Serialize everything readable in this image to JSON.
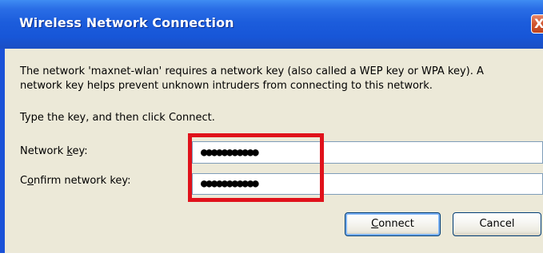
{
  "window": {
    "title": "Wireless Network Connection",
    "close_label": "X"
  },
  "message": {
    "line1": "The network 'maxnet-wlan' requires a network key (also called a WEP key or WPA key). A",
    "line2": "network key helps prevent unknown intruders from connecting to this network.",
    "instruction": "Type the key, and then click Connect."
  },
  "fields": {
    "network_key": {
      "label_pre": "Network ",
      "label_mnemonic": "k",
      "label_post": "ey:",
      "value": "●●●●●●●●●●●"
    },
    "confirm_key": {
      "label_pre": "C",
      "label_mnemonic": "o",
      "label_post": "nfirm network key:",
      "value": "●●●●●●●●●●●"
    }
  },
  "buttons": {
    "connect_mnemonic": "C",
    "connect_rest": "onnect",
    "cancel": "Cancel"
  },
  "colors": {
    "titlebar": "#1a52d8",
    "dialog_bg": "#ece9d8",
    "highlight": "#e0121b",
    "close_button": "#d0552e"
  }
}
